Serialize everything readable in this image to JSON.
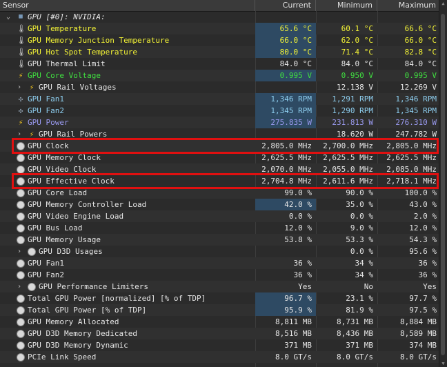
{
  "columns": {
    "sensor": "Sensor",
    "current": "Current",
    "minimum": "Minimum",
    "maximum": "Maximum"
  },
  "colors": {
    "accent_yellow": "#f5f536",
    "accent_green": "#40e040",
    "accent_cyan": "#8ecff0",
    "accent_blue": "#9a9af0",
    "highlight_red": "#e01010"
  },
  "rows": [
    {
      "label": "GPU [#0]: NVIDIA:",
      "icon": "gpu-icon",
      "expander": "v",
      "indent": 0,
      "color": "white",
      "italic": true,
      "cur": "",
      "min": "",
      "max": ""
    },
    {
      "label": "GPU Temperature",
      "icon": "thermometer-icon",
      "indent": 1,
      "color": "yellow",
      "cur": "65.6 °C",
      "min": "60.1 °C",
      "max": "66.6 °C",
      "hl": true
    },
    {
      "label": "GPU Memory Junction Temperature",
      "icon": "thermometer-icon",
      "indent": 1,
      "color": "yellow",
      "cur": "66.0 °C",
      "min": "62.0 °C",
      "max": "66.0 °C",
      "hl": true
    },
    {
      "label": "GPU Hot Spot Temperature",
      "icon": "thermometer-icon",
      "indent": 1,
      "color": "yellow",
      "cur": "80.0 °C",
      "min": "71.4 °C",
      "max": "82.8 °C",
      "hl": true
    },
    {
      "label": "GPU Thermal Limit",
      "icon": "thermometer-icon",
      "indent": 1,
      "color": "white",
      "cur": "84.0 °C",
      "min": "84.0 °C",
      "max": "84.0 °C"
    },
    {
      "label": "GPU Core Voltage",
      "icon": "lightning-icon",
      "indent": 1,
      "color": "green",
      "cur": "0.995 V",
      "min": "0.950 V",
      "max": "0.995 V",
      "hl": true
    },
    {
      "label": "GPU Rail Voltages",
      "icon": "lightning-icon",
      "expander": ">",
      "indent": 1,
      "color": "white",
      "cur": "",
      "min": "12.138 V",
      "max": "12.269 V"
    },
    {
      "label": "GPU Fan1",
      "icon": "fan-icon",
      "indent": 1,
      "color": "cyan",
      "cur": "1,346 RPM",
      "min": "1,291 RPM",
      "max": "1,346 RPM",
      "hl": true
    },
    {
      "label": "GPU Fan2",
      "icon": "fan-icon",
      "indent": 1,
      "color": "cyan",
      "cur": "1,345 RPM",
      "min": "1,290 RPM",
      "max": "1,345 RPM",
      "hl": true
    },
    {
      "label": "GPU Power",
      "icon": "lightning-icon",
      "indent": 1,
      "color": "blue",
      "cur": "275.835 W",
      "min": "231.813 W",
      "max": "276.310 W",
      "hl": true
    },
    {
      "label": "GPU Rail Powers",
      "icon": "lightning-icon",
      "expander": ">",
      "indent": 1,
      "color": "white",
      "cur": "",
      "min": "18.620 W",
      "max": "247.782 W"
    },
    {
      "label": "GPU Clock",
      "icon": "clock-icon",
      "indent": 1,
      "color": "white",
      "cur": "2,805.0 MHz",
      "min": "2,700.0 MHz",
      "max": "2,805.0 MHz"
    },
    {
      "label": "GPU Memory Clock",
      "icon": "clock-icon",
      "indent": 1,
      "color": "white",
      "cur": "2,625.5 MHz",
      "min": "2,625.5 MHz",
      "max": "2,625.5 MHz"
    },
    {
      "label": "GPU Video Clock",
      "icon": "clock-icon",
      "indent": 1,
      "color": "white",
      "cur": "2,070.0 MHz",
      "min": "2,055.0 MHz",
      "max": "2,085.0 MHz"
    },
    {
      "label": "GPU Effective Clock",
      "icon": "clock-icon",
      "indent": 1,
      "color": "white",
      "cur": "2,704.8 MHz",
      "min": "2,611.6 MHz",
      "max": "2,718.1 MHz"
    },
    {
      "label": "GPU Core Load",
      "icon": "clock-icon",
      "indent": 1,
      "color": "white",
      "cur": "99.0 %",
      "min": "90.0 %",
      "max": "100.0 %"
    },
    {
      "label": "GPU Memory Controller Load",
      "icon": "clock-icon",
      "indent": 1,
      "color": "white",
      "cur": "42.0 %",
      "min": "35.0 %",
      "max": "43.0 %",
      "hl": true
    },
    {
      "label": "GPU Video Engine Load",
      "icon": "clock-icon",
      "indent": 1,
      "color": "white",
      "cur": "0.0 %",
      "min": "0.0 %",
      "max": "2.0 %"
    },
    {
      "label": "GPU Bus Load",
      "icon": "clock-icon",
      "indent": 1,
      "color": "white",
      "cur": "12.0 %",
      "min": "9.0 %",
      "max": "12.0 %"
    },
    {
      "label": "GPU Memory Usage",
      "icon": "clock-icon",
      "indent": 1,
      "color": "white",
      "cur": "53.8 %",
      "min": "53.3 %",
      "max": "54.3 %"
    },
    {
      "label": "GPU D3D Usages",
      "icon": "clock-icon",
      "expander": ">",
      "indent": 1,
      "color": "white",
      "cur": "",
      "min": "0.0 %",
      "max": "95.6 %"
    },
    {
      "label": "GPU Fan1",
      "icon": "clock-icon",
      "indent": 1,
      "color": "white",
      "cur": "36 %",
      "min": "34 %",
      "max": "36 %"
    },
    {
      "label": "GPU Fan2",
      "icon": "clock-icon",
      "indent": 1,
      "color": "white",
      "cur": "36 %",
      "min": "34 %",
      "max": "36 %"
    },
    {
      "label": "GPU Performance Limiters",
      "icon": "clock-icon",
      "expander": ">",
      "indent": 1,
      "color": "white",
      "cur": "Yes",
      "min": "No",
      "max": "Yes"
    },
    {
      "label": "Total GPU Power [normalized] [% of TDP]",
      "icon": "clock-icon",
      "indent": 1,
      "color": "white",
      "cur": "96.7 %",
      "min": "23.1 %",
      "max": "97.7 %",
      "hl": true
    },
    {
      "label": "Total GPU Power [% of TDP]",
      "icon": "clock-icon",
      "indent": 1,
      "color": "white",
      "cur": "95.9 %",
      "min": "81.9 %",
      "max": "97.5 %",
      "hl": true
    },
    {
      "label": "GPU Memory Allocated",
      "icon": "clock-icon",
      "indent": 1,
      "color": "white",
      "cur": "8,811 MB",
      "min": "8,731 MB",
      "max": "8,884 MB"
    },
    {
      "label": "GPU D3D Memory Dedicated",
      "icon": "clock-icon",
      "indent": 1,
      "color": "white",
      "cur": "8,516 MB",
      "min": "8,436 MB",
      "max": "8,589 MB"
    },
    {
      "label": "GPU D3D Memory Dynamic",
      "icon": "clock-icon",
      "indent": 1,
      "color": "white",
      "cur": "371 MB",
      "min": "371 MB",
      "max": "374 MB"
    },
    {
      "label": "PCIe Link Speed",
      "icon": "clock-icon",
      "indent": 1,
      "color": "white",
      "cur": "8.0 GT/s",
      "min": "8.0 GT/s",
      "max": "8.0 GT/s"
    }
  ],
  "highlighted_rows": [
    "GPU Clock",
    "GPU Effective Clock"
  ]
}
